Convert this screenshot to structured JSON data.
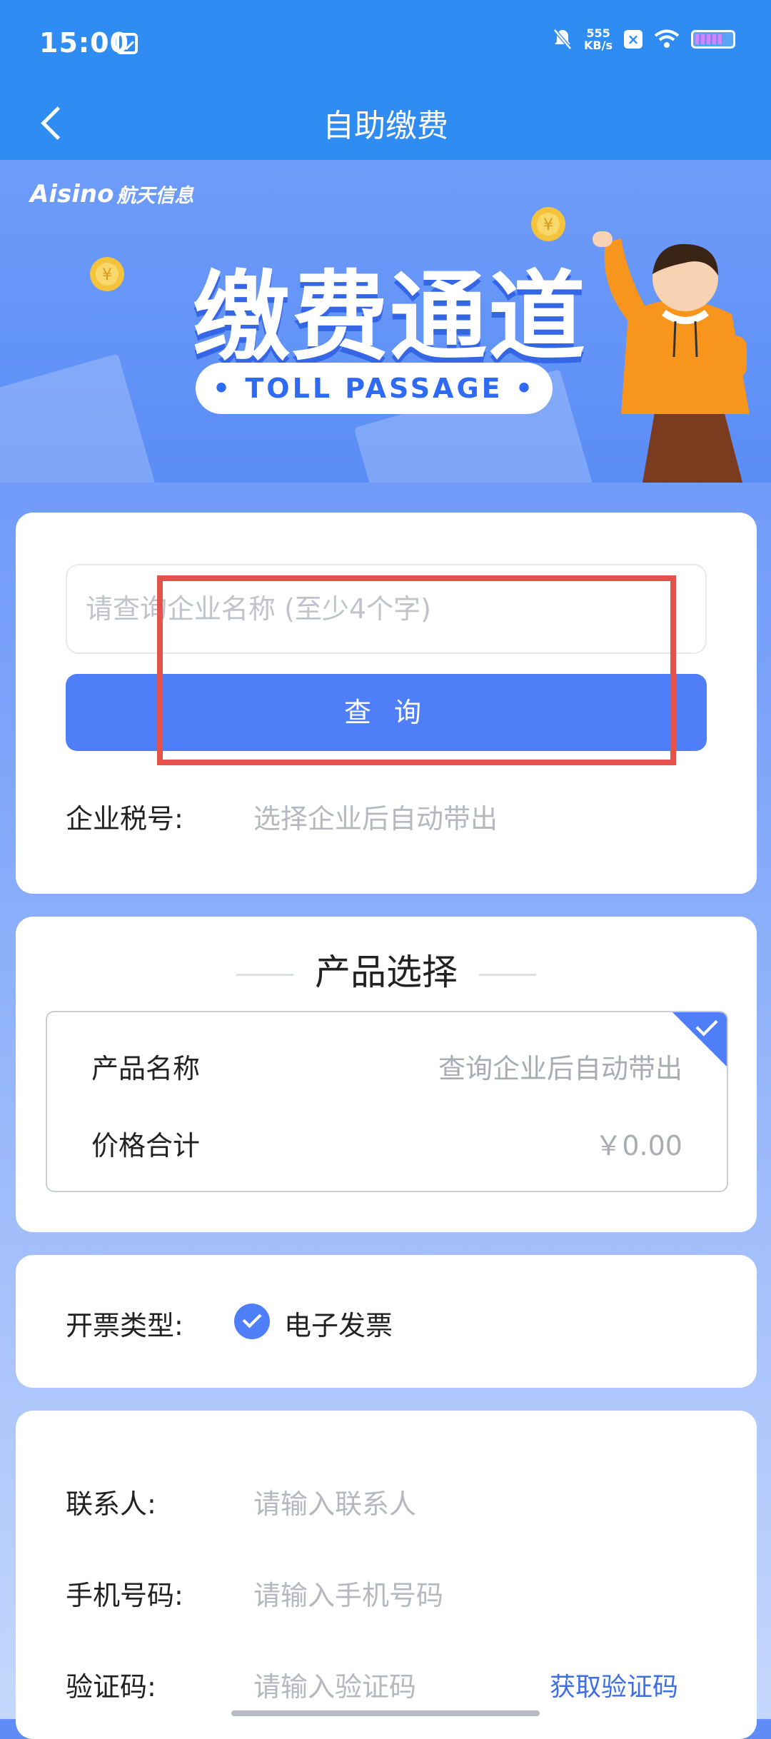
{
  "status": {
    "time": "15:00",
    "net_speed_top": "555",
    "net_speed_bottom": "KB/s"
  },
  "header": {
    "title": "自助缴费"
  },
  "banner": {
    "brand": "Aisino",
    "brand_sub": "航天信息",
    "title": "缴费通道",
    "subtitle": "• TOLL PASSAGE •"
  },
  "search": {
    "placeholder": "请查询企业名称 (至少4个字)",
    "button": "查 询",
    "tax_label": "企业税号:",
    "tax_value": "选择企业后自动带出"
  },
  "product": {
    "section_title": "产品选择",
    "name_label": "产品名称",
    "name_value": "查询企业后自动带出",
    "price_label": "价格合计",
    "price_value": "￥0.00"
  },
  "invoice": {
    "label": "开票类型:",
    "option": "电子发票"
  },
  "contact": {
    "name_label": "联系人:",
    "name_placeholder": "请输入联系人",
    "phone_label": "手机号码:",
    "phone_placeholder": "请输入手机号码",
    "code_label": "验证码:",
    "code_placeholder": "请输入验证码",
    "code_button": "获取验证码"
  },
  "colors": {
    "header": "#2f8cf2",
    "primary": "#4f7ff8",
    "highlight": "#e7514d"
  }
}
